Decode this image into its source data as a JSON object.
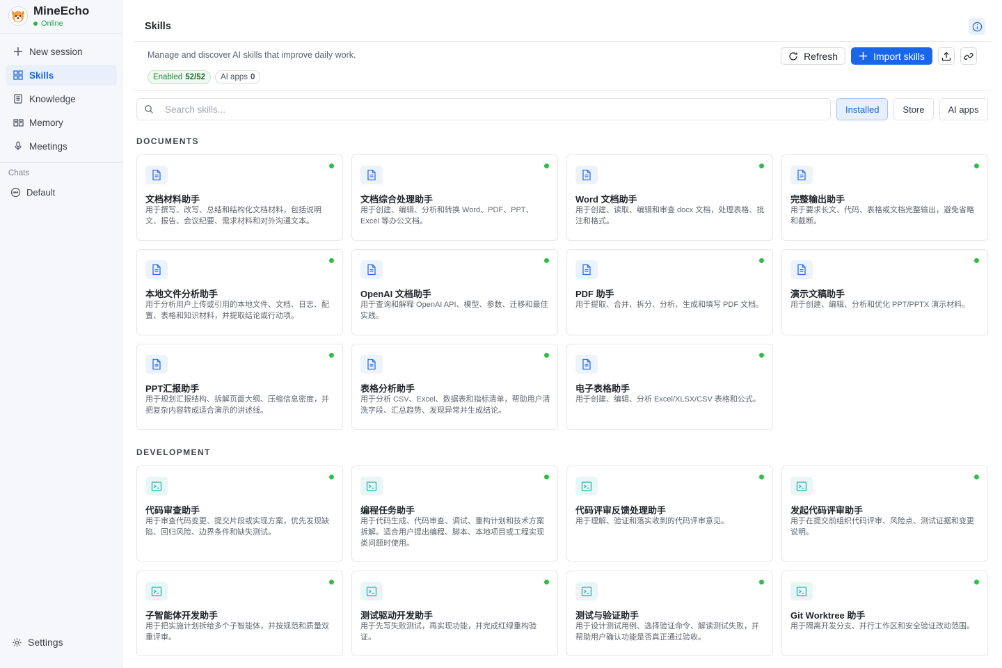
{
  "app": {
    "name": "MineEcho",
    "status": "Online",
    "avatar_icon": "shiba-dog-avatar"
  },
  "sidebar": {
    "items": [
      {
        "label": "New session",
        "icon": "plus-icon",
        "active": false
      },
      {
        "label": "Skills",
        "icon": "grid-icon",
        "active": true
      },
      {
        "label": "Knowledge",
        "icon": "book-icon",
        "active": false
      },
      {
        "label": "Memory",
        "icon": "open-book-icon",
        "active": false
      },
      {
        "label": "Meetings",
        "icon": "microphone-icon",
        "active": false
      }
    ],
    "chats_header": "Chats",
    "chats": [
      {
        "label": "Default",
        "icon": "chat-bubble-icon"
      }
    ],
    "settings_label": "Settings"
  },
  "header": {
    "title": "Skills",
    "subtitle": "Manage and discover AI skills that improve daily work.",
    "pills": [
      {
        "label": "Enabled",
        "value": "52/52"
      },
      {
        "label": "AI apps",
        "value": "0"
      }
    ],
    "refresh_label": "Refresh",
    "import_label": "Import skills"
  },
  "search": {
    "placeholder": "Search skills...",
    "value": ""
  },
  "tabs": [
    {
      "label": "Installed",
      "active": true
    },
    {
      "label": "Store",
      "active": false
    },
    {
      "label": "AI apps",
      "active": false
    }
  ],
  "colors": {
    "accent": "#1a66e8",
    "enabled_dot": "#2dbe44",
    "doc_icon": "#2f6fe0",
    "dev_icon": "#26b3a9"
  },
  "sections": [
    {
      "title": "DOCUMENTS",
      "icon": "document-icon",
      "cards": [
        {
          "title": "文档材料助手",
          "desc": "用于撰写、改写、总结和结构化文档材料，包括说明文、报告、会议纪要、需求材料和对外沟通文本。",
          "enabled": true
        },
        {
          "title": "文档综合处理助手",
          "desc": "用于创建、编辑、分析和转换 Word、PDF、PPT、Excel 等办公文档。",
          "enabled": true
        },
        {
          "title": "Word 文档助手",
          "desc": "用于创建、读取、编辑和审查 docx 文档，处理表格、批注和格式。",
          "enabled": true
        },
        {
          "title": "完整输出助手",
          "desc": "用于要求长文、代码、表格或文档完整输出，避免省略和截断。",
          "enabled": true
        },
        {
          "title": "本地文件分析助手",
          "desc": "用于分析用户上传或引用的本地文件、文档、日志、配置、表格和知识材料，并提取结论或行动项。",
          "enabled": true
        },
        {
          "title": "OpenAI 文档助手",
          "desc": "用于查询和解释 OpenAI API、模型、参数、迁移和最佳实践。",
          "enabled": true
        },
        {
          "title": "PDF 助手",
          "desc": "用于提取、合并、拆分、分析、生成和填写 PDF 文档。",
          "enabled": true
        },
        {
          "title": "演示文稿助手",
          "desc": "用于创建、编辑、分析和优化 PPT/PPTX 演示材料。",
          "enabled": true
        },
        {
          "title": "PPT汇报助手",
          "desc": "用于规划汇报结构、拆解页面大纲、压缩信息密度，并把复杂内容转成适合演示的讲述线。",
          "enabled": true
        },
        {
          "title": "表格分析助手",
          "desc": "用于分析 CSV、Excel、数据表和指标清单，帮助用户清洗字段、汇总趋势、发现异常并生成结论。",
          "enabled": true
        },
        {
          "title": "电子表格助手",
          "desc": "用于创建、编辑、分析 Excel/XLSX/CSV 表格和公式。",
          "enabled": true
        }
      ]
    },
    {
      "title": "DEVELOPMENT",
      "icon": "terminal-icon",
      "cards": [
        {
          "title": "代码审查助手",
          "desc": "用于审查代码变更、提交片段或实现方案，优先发现缺陷、回归风险、边界条件和缺失测试。",
          "enabled": true
        },
        {
          "title": "编程任务助手",
          "desc": "用于代码生成、代码审查、调试、重构计划和技术方案拆解。适合用户提出编程、脚本、本地项目或工程实现类问题时使用。",
          "enabled": true
        },
        {
          "title": "代码评审反馈处理助手",
          "desc": "用于理解、验证和落实收到的代码评审意见。",
          "enabled": true
        },
        {
          "title": "发起代码评审助手",
          "desc": "用于在提交前组织代码评审、风险点、测试证据和变更说明。",
          "enabled": true
        },
        {
          "title": "子智能体开发助手",
          "desc": "用于把实施计划拆给多个子智能体，并按规范和质量双重评审。",
          "enabled": true
        },
        {
          "title": "测试驱动开发助手",
          "desc": "用于先写失败测试，再实现功能，并完成红绿重构验证。",
          "enabled": true
        },
        {
          "title": "测试与验证助手",
          "desc": "用于设计测试用例、选择验证命令、解读测试失败，并帮助用户确认功能是否真正通过验收。",
          "enabled": true
        },
        {
          "title": "Git Worktree 助手",
          "desc": "用于隔离开发分支、并行工作区和安全验证改动范围。",
          "enabled": true
        }
      ]
    }
  ]
}
